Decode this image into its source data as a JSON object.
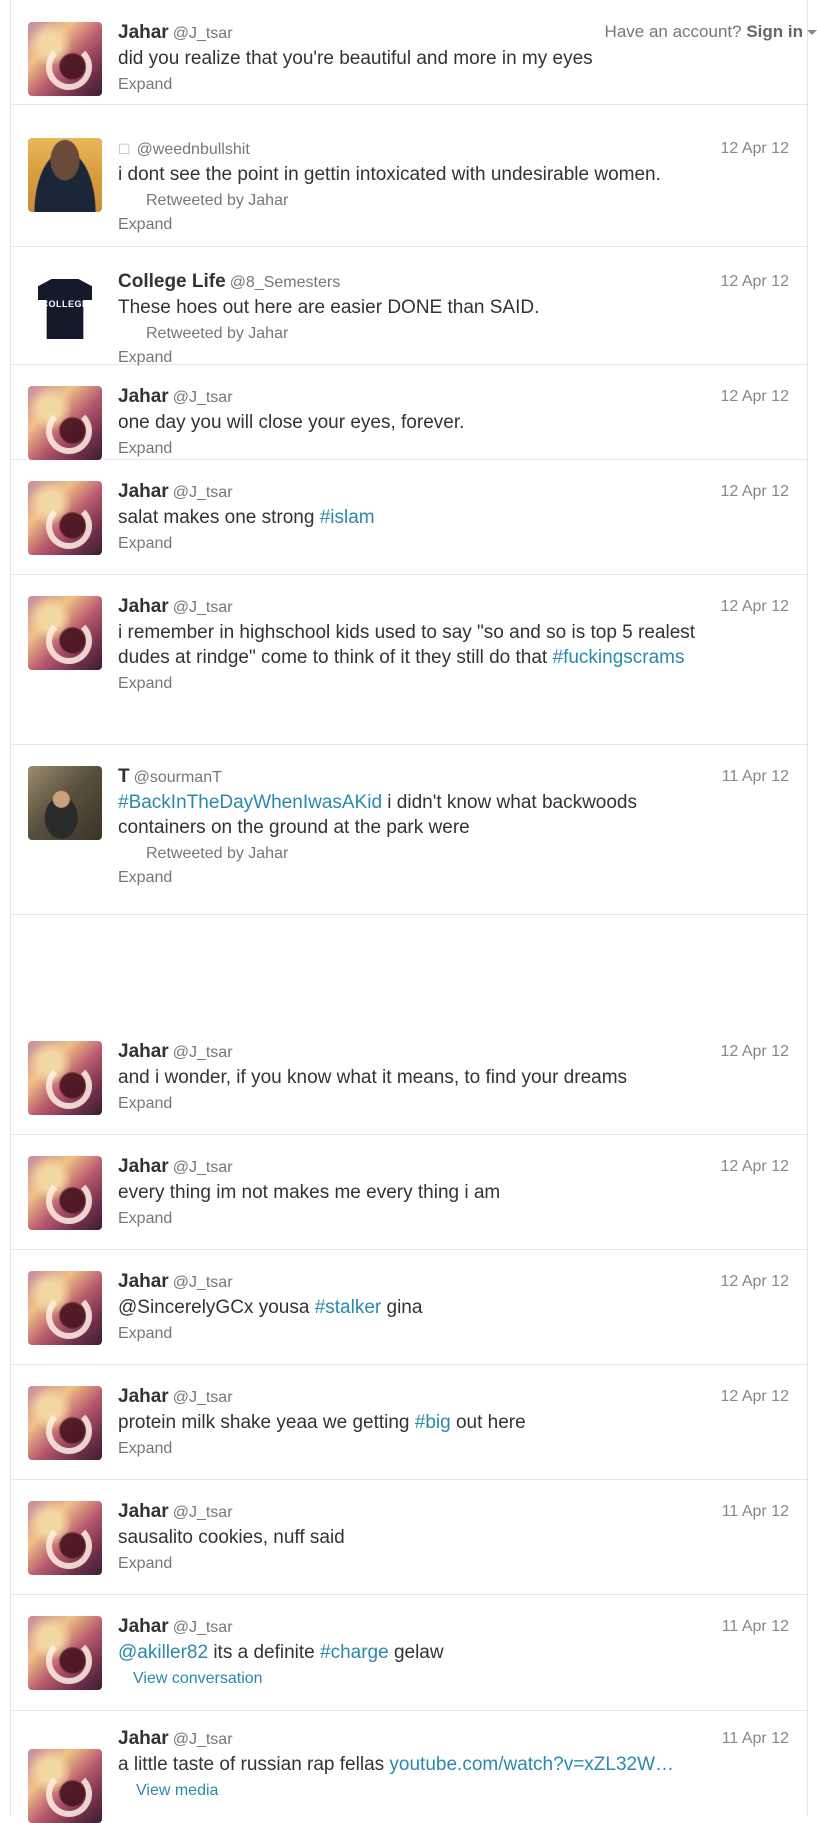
{
  "topbar": {
    "account_text": "Have an account?",
    "signin": "Sign in"
  },
  "tweets": [
    {
      "name": "Jahar",
      "handle": "@J_tsar",
      "time": "12 Apr 12",
      "pre": "did you realize that you're beautiful and more in my eyes",
      "tag": "",
      "post": "",
      "retweeted_by": "",
      "action": "Expand"
    },
    {
      "name": "",
      "icon": "☐",
      "handle": "@weednbullshit",
      "time": "12 Apr 12",
      "pre": "i dont see the point in gettin intoxicated with undesirable women.",
      "tag": "",
      "post": "",
      "retweeted_by": "Retweeted by Jahar",
      "action": "Expand"
    },
    {
      "name": "College Life",
      "handle": "@8_Semesters",
      "time": "12 Apr 12",
      "pre": "These hoes out here are easier DONE than SAID.",
      "tag": "",
      "post": "",
      "retweeted_by": "Retweeted by Jahar",
      "action": "Expand",
      "avatar_text": "COLLEGE"
    },
    {
      "name": "Jahar",
      "handle": "@J_tsar",
      "time": "12 Apr 12",
      "pre": "one day you will close your eyes, forever.",
      "tag": "",
      "post": "",
      "retweeted_by": "",
      "action": "Expand"
    },
    {
      "name": "Jahar",
      "handle": "@J_tsar",
      "time": "12 Apr 12",
      "pre": "salat makes one strong ",
      "tag": "#islam",
      "post": "",
      "retweeted_by": "",
      "action": "Expand"
    },
    {
      "name": "Jahar",
      "handle": "@J_tsar",
      "time": "12 Apr 12",
      "pre": "i remember in highschool kids used to say \"so and so is top 5 realest dudes at rindge\" come to think of it they still do that ",
      "tag": "#fuckingscrams",
      "post": "",
      "retweeted_by": "",
      "action": "Expand"
    },
    {
      "name": "T",
      "handle": "@sourmanT",
      "time": "11 Apr 12",
      "pre": "",
      "tag": "#BackInTheDayWhenIwasAKid",
      "post": " i didn't know what backwoods containers on the ground at the park were",
      "retweeted_by": "Retweeted by Jahar",
      "action": "Expand"
    },
    {
      "name": "Jahar",
      "handle": "@J_tsar",
      "time": "12 Apr 12",
      "pre": "and i wonder, if you know what it means, to find your dreams",
      "tag": "",
      "post": "",
      "retweeted_by": "",
      "action": "Expand"
    },
    {
      "name": "Jahar",
      "handle": "@J_tsar",
      "time": "12 Apr 12",
      "pre": "every thing im not makes me every thing i am",
      "tag": "",
      "post": "",
      "retweeted_by": "",
      "action": "Expand"
    },
    {
      "name": "Jahar",
      "handle": "@J_tsar",
      "time": "12 Apr 12",
      "pre": "@SincerelyGCx yousa ",
      "tag": "#stalker",
      "post": " gina",
      "retweeted_by": "",
      "action": "Expand"
    },
    {
      "name": "Jahar",
      "handle": "@J_tsar",
      "time": "12 Apr 12",
      "pre": "protein milk shake yeaa we getting ",
      "tag": "#big",
      "post": " out here",
      "retweeted_by": "",
      "action": "Expand"
    },
    {
      "name": "Jahar",
      "handle": "@J_tsar",
      "time": "11 Apr 12",
      "pre": "sausalito cookies, nuff said",
      "tag": "",
      "post": "",
      "retweeted_by": "",
      "action": "Expand"
    },
    {
      "name": "Jahar",
      "handle": "@J_tsar",
      "time": "11 Apr 12",
      "mention": "@akiller82",
      "pre": " its a definite ",
      "tag": "#charge",
      "post": " gelaw",
      "retweeted_by": "",
      "action": "View conversation"
    },
    {
      "name": "Jahar",
      "handle": "@J_tsar",
      "time": "11 Apr 12",
      "pre": "a little taste of russian rap fellas ",
      "tag": "youtube.com/watch?v=xZL32W…",
      "post": "",
      "retweeted_by": "",
      "action": "View media"
    }
  ]
}
